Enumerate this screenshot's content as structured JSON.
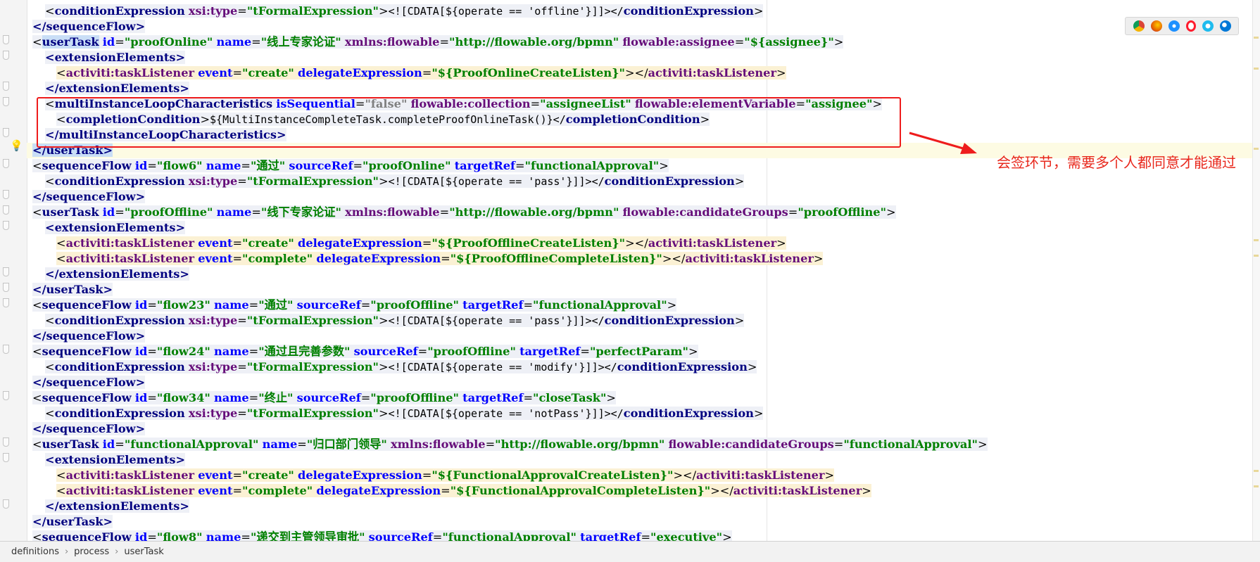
{
  "window": {
    "annotation_text": "会签环节，需要多个人都同意才能通过",
    "breadcrumbs": [
      "definitions",
      "process",
      "userTask"
    ],
    "browser_icons": [
      "chrome-icon",
      "firefox-icon",
      "safari-icon",
      "opera-icon",
      "ie-icon",
      "edge-icon"
    ],
    "colors": {
      "annotation": "#e8271b",
      "tag": "#000080",
      "attr": "#0000ff",
      "ns_attr": "#660e7a",
      "value": "#008000"
    }
  },
  "code": {
    "l01": {
      "cond": "conditionExpression",
      "xsi": "xsi:type",
      "eq": "=",
      "tfe": "\"tFormalExpression\"",
      "cdata": "<![CDATA[${operate == 'offline'}]]></",
      "cond2": "conditionExpression",
      "gt": ">"
    },
    "l02": {
      "text": "</sequenceFlow>"
    },
    "l03": {
      "usertask": "userTask",
      "id": "id",
      "idv": "\"proofOnline\"",
      "name": "name",
      "namev": "\"线上专家论证\"",
      "xmlns": "xmlns:flowable",
      "xmlnsv": "\"http://flowable.org/bpmn\"",
      "assignee": "flowable:assignee",
      "assigneev": "\"${assignee}\"",
      "gt": ">"
    },
    "l04": {
      "text": "<extensionElements>"
    },
    "l05": {
      "tl": "activiti:taskListener",
      "event": "event",
      "eventv": "\"create\"",
      "de": "delegateExpression",
      "dev": "\"${ProofOnlineCreateListen}\"",
      "close": "></",
      "tl2": "activiti:taskListener",
      "gt": ">"
    },
    "l06": {
      "text": "</extensionElements>"
    },
    "l07": {
      "milc": "multiInstanceLoopCharacteristics",
      "seq": "isSequential",
      "seqv": "\"false\"",
      "coll": "flowable:collection",
      "collv": "\"assigneeList\"",
      "ev": "flowable:elementVariable",
      "evv": "\"assignee\"",
      "gt": ">"
    },
    "l08": {
      "cc": "completionCondition",
      "expr": "${MultiInstanceCompleteTask.completeProofOnlineTask()}</",
      "cc2": "completionCondition",
      "gt": ">"
    },
    "l09": {
      "text": "</multiInstanceLoopCharacteristics>"
    },
    "l10": {
      "text": "</userTask>"
    },
    "l11": {
      "sf": "sequenceFlow",
      "id": "id",
      "idv": "\"flow6\"",
      "name": "name",
      "namev": "\"通过\"",
      "src": "sourceRef",
      "srcv": "\"proofOnline\"",
      "tgt": "targetRef",
      "tgtv": "\"functionalApproval\"",
      "gt": ">"
    },
    "l12": {
      "cond": "conditionExpression",
      "xsi": "xsi:type",
      "tfe": "\"tFormalExpression\"",
      "cdata": "<![CDATA[${operate == 'pass'}]]></",
      "cond2": "conditionExpression",
      "gt": ">"
    },
    "l13": {
      "text": "</sequenceFlow>"
    },
    "l14": {
      "usertask": "userTask",
      "id": "id",
      "idv": "\"proofOffline\"",
      "name": "name",
      "namev": "\"线下专家论证\"",
      "xmlns": "xmlns:flowable",
      "xmlnsv": "\"http://flowable.org/bpmn\"",
      "cg": "flowable:candidateGroups",
      "cgv": "\"proofOffline\"",
      "gt": ">"
    },
    "l15": {
      "text": "<extensionElements>"
    },
    "l16": {
      "tl": "activiti:taskListener",
      "event": "event",
      "eventv": "\"create\"",
      "de": "delegateExpression",
      "dev": "\"${ProofOfflineCreateListen}\"",
      "close": "></",
      "tl2": "activiti:taskListener",
      "gt": ">"
    },
    "l17": {
      "tl": "activiti:taskListener",
      "event": "event",
      "eventv": "\"complete\"",
      "de": "delegateExpression",
      "dev": "\"${ProofOfflineCompleteListen}\"",
      "close": "></",
      "tl2": "activiti:taskListener",
      "gt": ">"
    },
    "l18": {
      "text": "</extensionElements>"
    },
    "l19": {
      "text": "</userTask>"
    },
    "l20": {
      "sf": "sequenceFlow",
      "id": "id",
      "idv": "\"flow23\"",
      "name": "name",
      "namev": "\"通过\"",
      "src": "sourceRef",
      "srcv": "\"proofOffline\"",
      "tgt": "targetRef",
      "tgtv": "\"functionalApproval\"",
      "gt": ">"
    },
    "l21": {
      "cond": "conditionExpression",
      "xsi": "xsi:type",
      "tfe": "\"tFormalExpression\"",
      "cdata": "<![CDATA[${operate == 'pass'}]]></",
      "cond2": "conditionExpression",
      "gt": ">"
    },
    "l22": {
      "text": "</sequenceFlow>"
    },
    "l23": {
      "sf": "sequenceFlow",
      "id": "id",
      "idv": "\"flow24\"",
      "name": "name",
      "namev": "\"通过且完善参数\"",
      "src": "sourceRef",
      "srcv": "\"proofOffline\"",
      "tgt": "targetRef",
      "tgtv": "\"perfectParam\"",
      "gt": ">"
    },
    "l24": {
      "cond": "conditionExpression",
      "xsi": "xsi:type",
      "tfe": "\"tFormalExpression\"",
      "cdata": "<![CDATA[${operate == 'modify'}]]></",
      "cond2": "conditionExpression",
      "gt": ">"
    },
    "l25": {
      "text": "</sequenceFlow>"
    },
    "l26": {
      "sf": "sequenceFlow",
      "id": "id",
      "idv": "\"flow34\"",
      "name": "name",
      "namev": "\"终止\"",
      "src": "sourceRef",
      "srcv": "\"proofOffline\"",
      "tgt": "targetRef",
      "tgtv": "\"closeTask\"",
      "gt": ">"
    },
    "l27": {
      "cond": "conditionExpression",
      "xsi": "xsi:type",
      "tfe": "\"tFormalExpression\"",
      "cdata": "<![CDATA[${operate == 'notPass'}]]></",
      "cond2": "conditionExpression",
      "gt": ">"
    },
    "l28": {
      "text": "</sequenceFlow>"
    },
    "l29": {
      "usertask": "userTask",
      "id": "id",
      "idv": "\"functionalApproval\"",
      "name": "name",
      "namev": "\"归口部门领导\"",
      "xmlns": "xmlns:flowable",
      "xmlnsv": "\"http://flowable.org/bpmn\"",
      "cg": "flowable:candidateGroups",
      "cgv": "\"functionalApproval\"",
      "gt": ">"
    },
    "l30": {
      "text": "<extensionElements>"
    },
    "l31": {
      "tl": "activiti:taskListener",
      "event": "event",
      "eventv": "\"create\"",
      "de": "delegateExpression",
      "dev": "\"${FunctionalApprovalCreateListen}\"",
      "close": "></",
      "tl2": "activiti:taskListener",
      "gt": ">"
    },
    "l32": {
      "tl": "activiti:taskListener",
      "event": "event",
      "eventv": "\"complete\"",
      "de": "delegateExpression",
      "dev": "\"${FunctionalApprovalCompleteListen}\"",
      "close": "></",
      "tl2": "activiti:taskListener",
      "gt": ">"
    },
    "l33": {
      "text": "</extensionElements>"
    },
    "l34": {
      "text": "</userTask>"
    },
    "l35": {
      "sf": "sequenceFlow",
      "id": "id",
      "idv": "\"flow8\"",
      "name": "name",
      "namev": "\"递交到主管领导审批\"",
      "src": "sourceRef",
      "srcv": "\"functionalApproval\"",
      "tgt": "targetRef",
      "tgtv": "\"executive\"",
      "gt": ">"
    }
  }
}
